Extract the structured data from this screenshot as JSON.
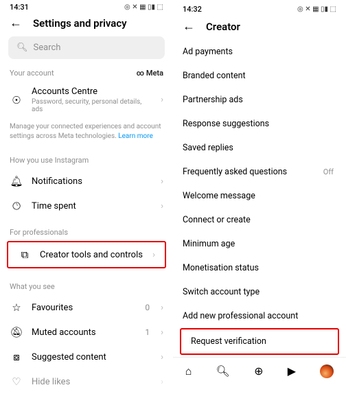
{
  "left": {
    "time": "14:31",
    "title": "Settings and privacy",
    "search_placeholder": "Search",
    "your_account_label": "Your account",
    "meta_brand": "Meta",
    "accounts_centre": {
      "title": "Accounts Centre",
      "sub": "Password, security, personal details, ads"
    },
    "fine_text": "Manage your connected experiences and account settings across Meta technologies. ",
    "learn_more": "Learn more",
    "section_how": "How you use Instagram",
    "notifications": "Notifications",
    "time_spent": "Time spent",
    "section_pro": "For professionals",
    "creator_tools": "Creator tools and controls",
    "section_see": "What you see",
    "favourites": {
      "label": "Favourites",
      "trail": "0"
    },
    "muted": {
      "label": "Muted accounts",
      "trail": "1"
    },
    "suggested": "Suggested content",
    "hide_likes": "Hide likes"
  },
  "right": {
    "time": "14:32",
    "title": "Creator",
    "items": [
      "Ad payments",
      "Branded content",
      "Partnership ads",
      "Response suggestions",
      "Saved replies",
      "Frequently asked questions",
      "Welcome message",
      "Connect or create",
      "Minimum age",
      "Monetisation status",
      "Switch account type",
      "Add new professional account",
      "Request verification"
    ],
    "faq_trail": "Off"
  }
}
